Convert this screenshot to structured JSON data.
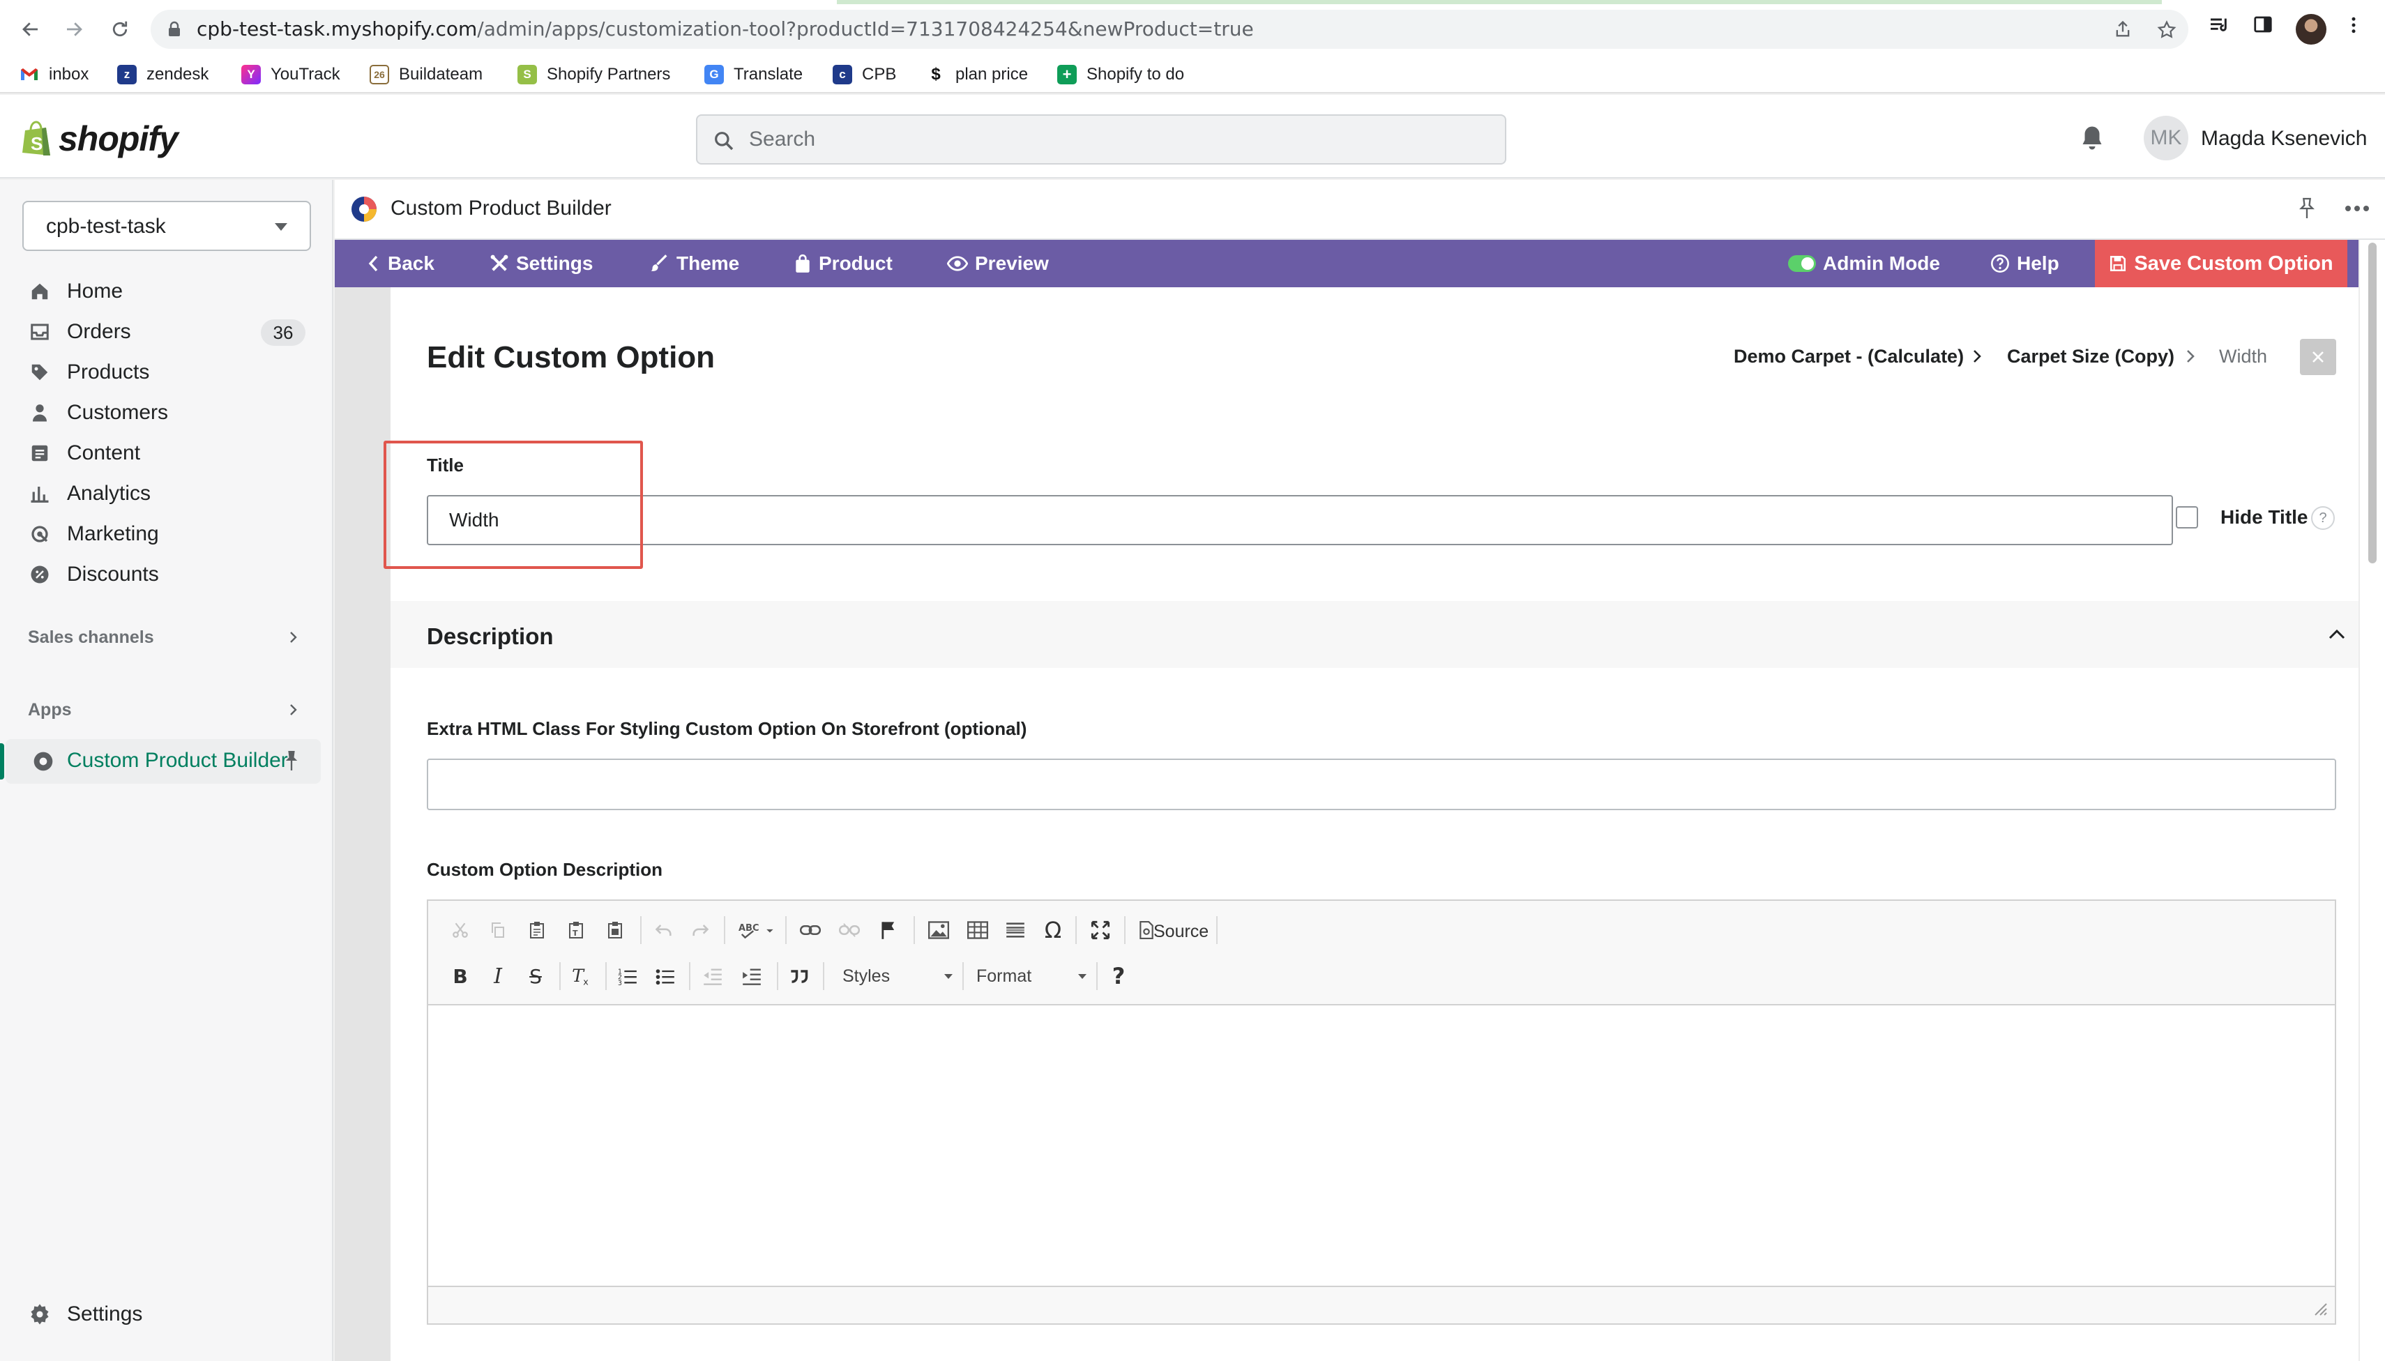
{
  "browser": {
    "url_host": "cpb-test-task.myshopify.com",
    "url_path": "/admin/apps/customization-tool?productId=7131708424254&newProduct=true",
    "bookmarks": [
      "inbox",
      "zendesk",
      "YouTrack",
      "Buildateam",
      "Shopify Partners",
      "Translate",
      "CPB",
      "plan price",
      "Shopify to do"
    ]
  },
  "topbar": {
    "logo_text": "shopify",
    "search_placeholder": "Search",
    "user_initials": "MK",
    "user_name": "Magda Ksenevich"
  },
  "sidebar": {
    "store_name": "cpb-test-task",
    "nav": [
      {
        "label": "Home",
        "icon": "home-icon"
      },
      {
        "label": "Orders",
        "icon": "orders-icon",
        "badge": "36"
      },
      {
        "label": "Products",
        "icon": "tag-icon"
      },
      {
        "label": "Customers",
        "icon": "person-icon"
      },
      {
        "label": "Content",
        "icon": "content-icon"
      },
      {
        "label": "Analytics",
        "icon": "analytics-icon"
      },
      {
        "label": "Marketing",
        "icon": "marketing-icon"
      },
      {
        "label": "Discounts",
        "icon": "discount-icon"
      }
    ],
    "sales_channels": "Sales channels",
    "apps": "Apps",
    "active_app": "Custom Product Builder",
    "settings": "Settings"
  },
  "app_header": {
    "title": "Custom Product Builder"
  },
  "app_toolbar": {
    "back": "Back",
    "settings": "Settings",
    "theme": "Theme",
    "product": "Product",
    "preview": "Preview",
    "admin_mode": "Admin Mode",
    "help": "Help",
    "save": "Save Custom Option",
    "accent_color": "#6b5ca5",
    "save_color": "#e8595a"
  },
  "editor_page": {
    "heading": "Edit Custom Option",
    "breadcrumbs": [
      "Demo Carpet - (Calculate)",
      "Carpet Size (Copy)",
      "Width"
    ],
    "title_label": "Title",
    "title_value": "Width",
    "hide_title_label": "Hide Title",
    "help_mark": "?",
    "description_section": "Description",
    "extra_class_label": "Extra HTML Class For Styling Custom Option On Storefront (optional)",
    "extra_class_value": "",
    "custom_description_label": "Custom Option Description",
    "rte": {
      "source": "Source",
      "styles": "Styles",
      "format": "Format"
    }
  }
}
